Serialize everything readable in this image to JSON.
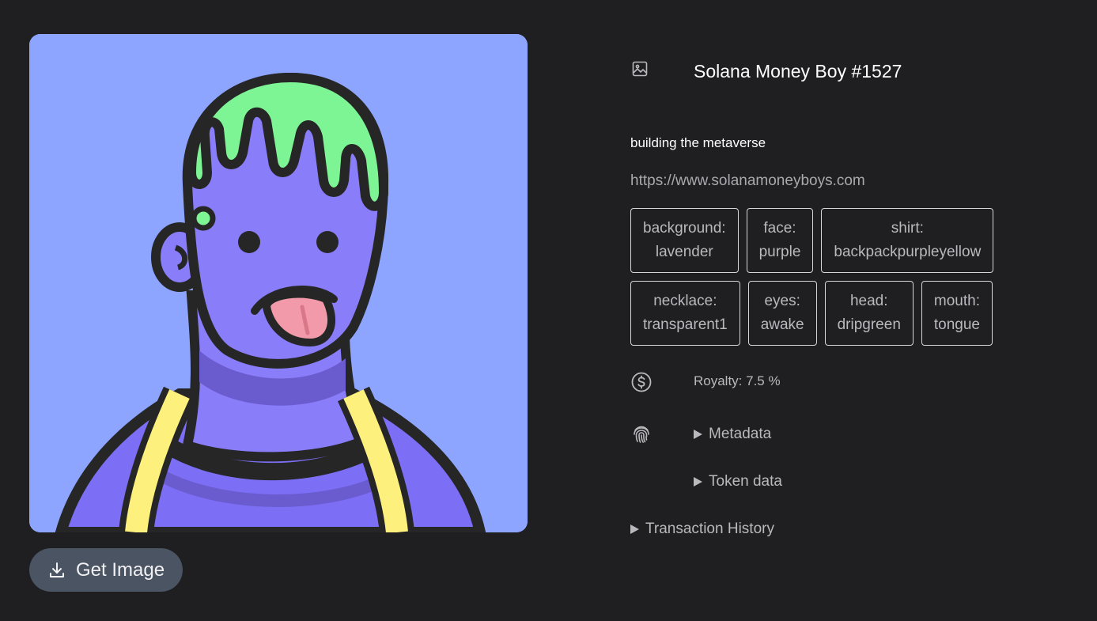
{
  "nft": {
    "title": "Solana Money Boy #1527",
    "description": "building the metaverse",
    "external_url": "https://www.solanamoneyboys.com"
  },
  "attributes": [
    {
      "trait": "background:",
      "value": "lavender"
    },
    {
      "trait": "face:",
      "value": "purple"
    },
    {
      "trait": "shirt:",
      "value": "backpackpurpleyellow"
    },
    {
      "trait": "necklace:",
      "value": "transparent1"
    },
    {
      "trait": "eyes:",
      "value": "awake"
    },
    {
      "trait": "head:",
      "value": "dripgreen"
    },
    {
      "trait": "mouth:",
      "value": "tongue"
    }
  ],
  "royalty": {
    "label": "Royalty: 7.5 %"
  },
  "sections": {
    "metadata": "Metadata",
    "token_data": "Token data",
    "transaction_history": "Transaction History"
  },
  "actions": {
    "get_image": "Get Image"
  },
  "icons": {
    "title": "image-icon",
    "royalty": "dollar-circle-icon",
    "metadata": "fingerprint-icon",
    "download": "download-icon"
  },
  "colors": {
    "background": "#1f1e21",
    "art_background": "#8ea5ff",
    "button": "#4b5462"
  }
}
